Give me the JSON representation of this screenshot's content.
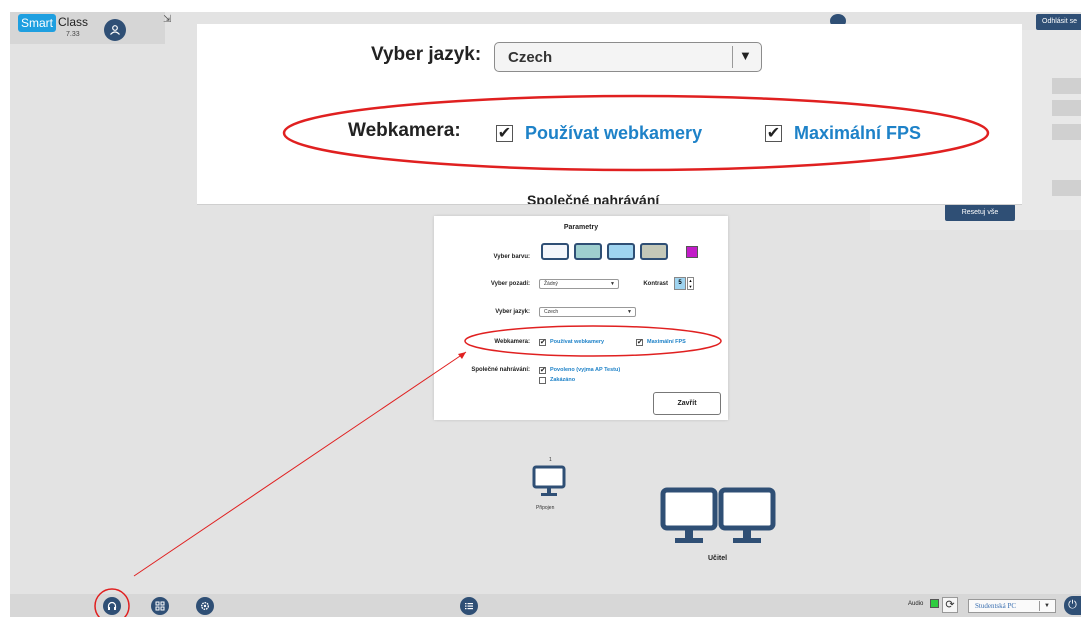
{
  "app": {
    "logo_part1": "Smart",
    "logo_part2": "Class",
    "version": "7.33",
    "top_right_button": "Odhlásit se",
    "reset_button": "Resetuj vše"
  },
  "zoom": {
    "language_label": "Vyber jazyk:",
    "language_value": "Czech",
    "webcam_label": "Webkamera:",
    "use_webcams": "Používat webkamery",
    "max_fps": "Maximální FPS",
    "cut_text": "Společné nahrávání"
  },
  "dialog": {
    "title": "Parametry",
    "color_label": "Vyber barvu:",
    "background_label": "Vyber pozadí:",
    "background_value": "Žádný",
    "contrast_label": "Kontrast",
    "contrast_value": "5",
    "language_label": "Vyber jazyk:",
    "language_value": "Czech",
    "webcam_label": "Webkamera:",
    "use_webcams": "Používat webkamery",
    "max_fps": "Maximální FPS",
    "recording_label": "Společné nahrávání:",
    "recording_allowed": "Povoleno (vyjma AP Testu)",
    "recording_forbidden": "Zakázáno",
    "close_button": "Zavřít",
    "swatch_colors": [
      "#f4f6fb",
      "#9ecfcf",
      "#9fd4f0",
      "#c4c8b8"
    ],
    "accent_swatch": "#c21cc8"
  },
  "classroom": {
    "student_number": "1",
    "student_status": "Připojen",
    "teacher_label": "Učitel"
  },
  "bottombar": {
    "audio_label": "Audio",
    "pc_select": "Studentská PC"
  },
  "colors": {
    "primary": "#2f4f75",
    "link": "#1e82c8",
    "annotation": "#e02020"
  }
}
